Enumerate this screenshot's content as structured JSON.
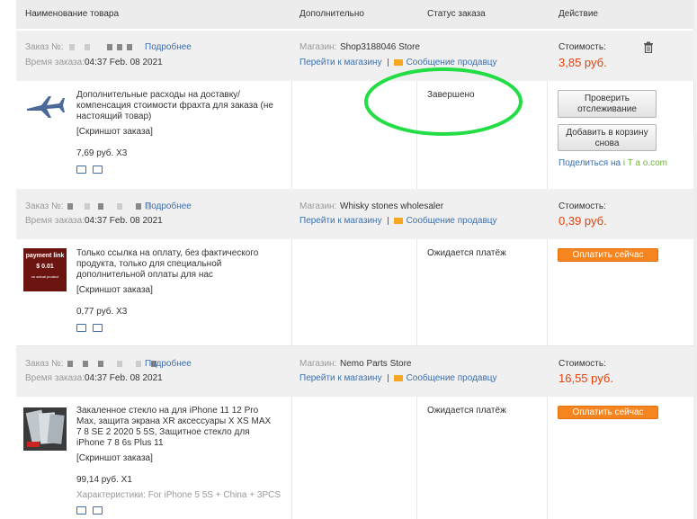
{
  "header": {
    "col_product": "Наименование товара",
    "col_extra": "Дополнительно",
    "col_status": "Статус заказа",
    "col_action": "Действие"
  },
  "labels": {
    "order_no": "Заказ №:",
    "more": "Подробнее",
    "order_time": "Время заказа:",
    "store": "Магазин:",
    "go_store": "Перейти к магазину",
    "message_seller": "Сообщение продавцу",
    "cost": "Стоимость:",
    "screenshot": "[Скриншот заказа]"
  },
  "orders": [
    {
      "time": "04:37 Feb. 08 2021",
      "store_name": "Shop3188046 Store",
      "cost": "3,85 руб.",
      "title": "Дополнительные расходы на доставку/ компенсация стоимости фрахта для заказа (не настоящий товар)",
      "price_qty": "7,69 руб. X3",
      "status": "Завершено",
      "btn_track": "Проверить отслеживание",
      "btn_add_cart": "Добавить в корзину снова",
      "share": "Поделиться на",
      "share_site": "i T a o.com"
    },
    {
      "time": "04:37 Feb. 08 2021",
      "store_name": "Whisky stones wholesaler",
      "cost": "0,39 руб.",
      "title": "Только ссылка на оплату, без фактического продукта, только для специальной дополнительной оплаты для нас",
      "price_qty": "0,77 руб. X3",
      "status": "Ожидается платёж",
      "btn_pay": "Оплатить сейчас",
      "thumb_text1": "payment link",
      "thumb_text2": "$ 0.01",
      "thumb_text3": "no actual product"
    },
    {
      "time": "04:37 Feb. 08 2021",
      "store_name": "Nemo Parts Store",
      "cost": "16,55 руб.",
      "title": "Закаленное стекло на для iPhone 11 12 Pro Max, защита экрана XR аксессуары X XS MAX 7 8 SE 2 2020 5 5S, Защитное стекло для iPhone 7 8 6s Plus 11",
      "price_qty": "99,14 руб. X1",
      "characteristics": "Характеристики: For iPhone 5 5S + China + 3PCS",
      "status": "Ожидается платёж",
      "btn_pay": "Оплатить сейчас"
    }
  ],
  "colors": {
    "accent": "#f6851f",
    "price": "#e8400c",
    "link": "#3a6fb0",
    "highlight_circle": "#22dd44"
  }
}
